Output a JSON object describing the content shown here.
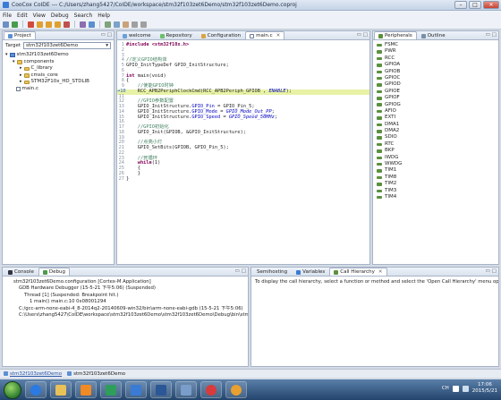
{
  "window": {
    "title": "CooCox CoIDE --- C:/Users/zhang5427/CoIDE/workspace/stm32f103zet6Demo/stm32f103zet6Demo.coproj",
    "btn_min": "–",
    "btn_max": "□",
    "btn_close": "✕"
  },
  "menu": [
    "File",
    "Edit",
    "View",
    "Debug",
    "Search",
    "Help"
  ],
  "project_panel": {
    "tab": "Project",
    "target_label": "Target",
    "target_value": "stm32f103zet6Demo",
    "tree": [
      {
        "label": "stm32f103zet6Demo",
        "depth": 0,
        "kind": "project"
      },
      {
        "label": "components",
        "depth": 1,
        "kind": "folder"
      },
      {
        "label": "C_library",
        "depth": 2,
        "kind": "folder"
      },
      {
        "label": "cmsis_core",
        "depth": 2,
        "kind": "folder"
      },
      {
        "label": "STM32F10x_HD_STDLIB",
        "depth": 2,
        "kind": "folder"
      },
      {
        "label": "main.c",
        "depth": 1,
        "kind": "file"
      }
    ]
  },
  "editor": {
    "tabs": [
      "welcome",
      "Repository",
      "Configuration",
      "main.c"
    ],
    "active_tab": 3
  },
  "code": {
    "l1_inc": "#include <stm32f10x.h>",
    "l4_cm": "//定义GPIO结构体",
    "l5": "GPIO_InitTypeDef GPIO_InitStructure;",
    "l7_kw": "int",
    "l7_rest": " main(void)",
    "l8": "{",
    "l9_cm": "//使能GPIO时钟",
    "l10_fn": "RCC_APB2PeriphClockCmd(RCC_APB2Periph_GPIOB , ",
    "l10_arg": "ENABLE",
    "l10_end": ");",
    "l12_cm": "//GPIO参数配置",
    "l13_a": "GPIO_InitStructure.",
    "l13_f": "GPIO_Pin",
    "l13_b": " = GPIO_Pin_5;",
    "l14_f": "GPIO_Mode",
    "l14_b": " = ",
    "l14_v": "GPIO_Mode_Out_PP",
    "l15_f": "GPIO_Speed",
    "l15_v": "GPIO_Speed_50MHz",
    "semi": ";",
    "l17_cm": "//GPIO初始化",
    "l18": "GPIO_Init(GPIOB, &GPIO_InitStructure);",
    "l20_cm": "//点亮小灯",
    "l21": "GPIO_SetBits(GPIOB, GPIO_Pin_5);",
    "l23_cm": "//死循环",
    "l24_kw": "while",
    "l24_rest": "(1)",
    "l25": "{",
    "l26": "}",
    "l27": "}"
  },
  "peripherals_panel": {
    "tabs": [
      "Peripherals",
      "Outline"
    ],
    "items": [
      "FSMC",
      "PWR",
      "RCC",
      "GPIOA",
      "GPIOB",
      "GPIOC",
      "GPIOD",
      "GPIOE",
      "GPIOF",
      "GPIOG",
      "AFIO",
      "EXTI",
      "DMA1",
      "DMA2",
      "SDIO",
      "RTC",
      "BKP",
      "IWDG",
      "WWDG",
      "TIM1",
      "TIM8",
      "TIM2",
      "TIM3",
      "TIM4"
    ]
  },
  "debug_panel": {
    "tabs": [
      "Console",
      "Debug"
    ],
    "rows": [
      {
        "text": "stm32f103zet6Demo.configuration [Cortex-M Application]",
        "indent": 0
      },
      {
        "text": "GDB Hardware Debugger (15-5-21 下午5:06) (Suspended)",
        "indent": 1
      },
      {
        "text": "Thread [1] (Suspended: Breakpoint hit.)",
        "indent": 2
      },
      {
        "text": "1 main() main.c:10 0x08001294",
        "indent": 3
      },
      {
        "text": "C:/gcc-arm-none-eabi-4_8-2014q2-20140609-win32/bin\\arm-none-eabi-gdb (15-5-21 下午5:06)",
        "indent": 1
      },
      {
        "text": "C:\\Users\\zhang5427\\CoIDE\\workspace\\stm32f103zet6Demo\\stm32f103zet6Demo\\Debug\\bin\\stm32f103zet6De",
        "indent": 1
      }
    ]
  },
  "hierarchy_panel": {
    "tabs": [
      "Semihosting",
      "Variables",
      "Call Hierarchy"
    ],
    "message": "To display the call hierarchy, select a function or method and select the 'Open Call Hierarchy' menu option."
  },
  "statusbar": {
    "left": "stm32f103zet6Demo",
    "right": "stm32f103zet6Demo"
  },
  "taskbar": {
    "lang": "CH",
    "time": "17:06",
    "date": "2015/5/21"
  },
  "colors": {
    "accent": "#3a7bd5",
    "highlight_line": "#e8f2a6",
    "keyword": "#7f0055",
    "comment": "#3f7f5f",
    "field": "#0000c0"
  }
}
